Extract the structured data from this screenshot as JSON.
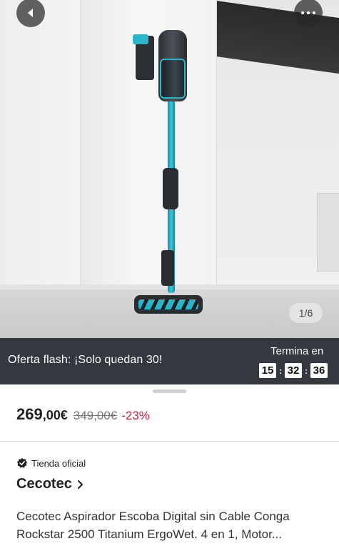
{
  "gallery": {
    "counter": "1/6"
  },
  "flash": {
    "text": "Oferta flash: ¡Solo quedan 30!",
    "ends_label": "Termina en",
    "hours": "15",
    "minutes": "32",
    "seconds": "36",
    "separator": ":"
  },
  "price": {
    "integer": "269",
    "decimal": ",00€",
    "original": "349,00€",
    "discount": "-23%"
  },
  "store": {
    "badge_label": "Tienda oficial",
    "brand": "Cecotec"
  },
  "product": {
    "title": "Cecotec Aspirador Escoba Digital sin Cable Conga Rockstar 2500 Titanium ErgoWet. 4 en 1, Motor..."
  },
  "icons": {
    "back": "chevron-left-icon",
    "more": "more-horizontal-icon",
    "official_store": "verified-badge-icon",
    "brand_chevron": "chevron-right-icon"
  },
  "colors": {
    "flash_bg": "#34393f",
    "discount": "#c4243a",
    "accent_product": "#2bb6cc"
  }
}
